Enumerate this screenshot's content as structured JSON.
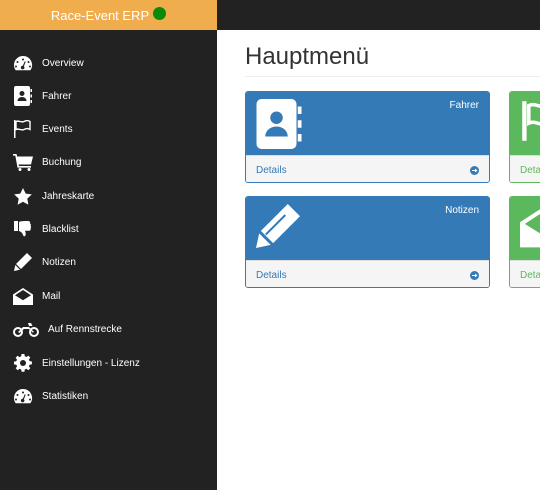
{
  "app": {
    "title": "Race-Event ERP",
    "status_color": "#0a8a0a",
    "brand_color": "#f0ad4e"
  },
  "sidebar": {
    "items": [
      {
        "label": "Overview",
        "icon": "dashboard-icon"
      },
      {
        "label": "Fahrer",
        "icon": "address-book-icon"
      },
      {
        "label": "Events",
        "icon": "flag-icon"
      },
      {
        "label": "Buchung",
        "icon": "shopping-cart-icon"
      },
      {
        "label": "Jahreskarte",
        "icon": "star-icon"
      },
      {
        "label": "Blacklist",
        "icon": "thumbs-down-icon"
      },
      {
        "label": "Notizen",
        "icon": "pencil-icon"
      },
      {
        "label": "Mail",
        "icon": "envelope-open-icon"
      },
      {
        "label": "Auf Rennstrecke",
        "icon": "motorcycle-icon"
      },
      {
        "label": "Einstellungen - Lizenz",
        "icon": "gear-icon"
      },
      {
        "label": "Statistiken",
        "icon": "dashboard-icon"
      }
    ]
  },
  "main": {
    "title": "Hauptmenü",
    "panels": [
      {
        "title": "Fahrer",
        "footer": "Details",
        "icon": "address-book-icon",
        "color": "#337ab7"
      },
      {
        "title": "",
        "footer": "Details",
        "icon": "flag-icon",
        "color": "#5cb85c"
      },
      {
        "title": "Notizen",
        "footer": "Details",
        "icon": "pencil-icon",
        "color": "#337ab7"
      },
      {
        "title": "",
        "footer": "Details",
        "icon": "envelope-open-icon",
        "color": "#5cb85c"
      }
    ]
  }
}
